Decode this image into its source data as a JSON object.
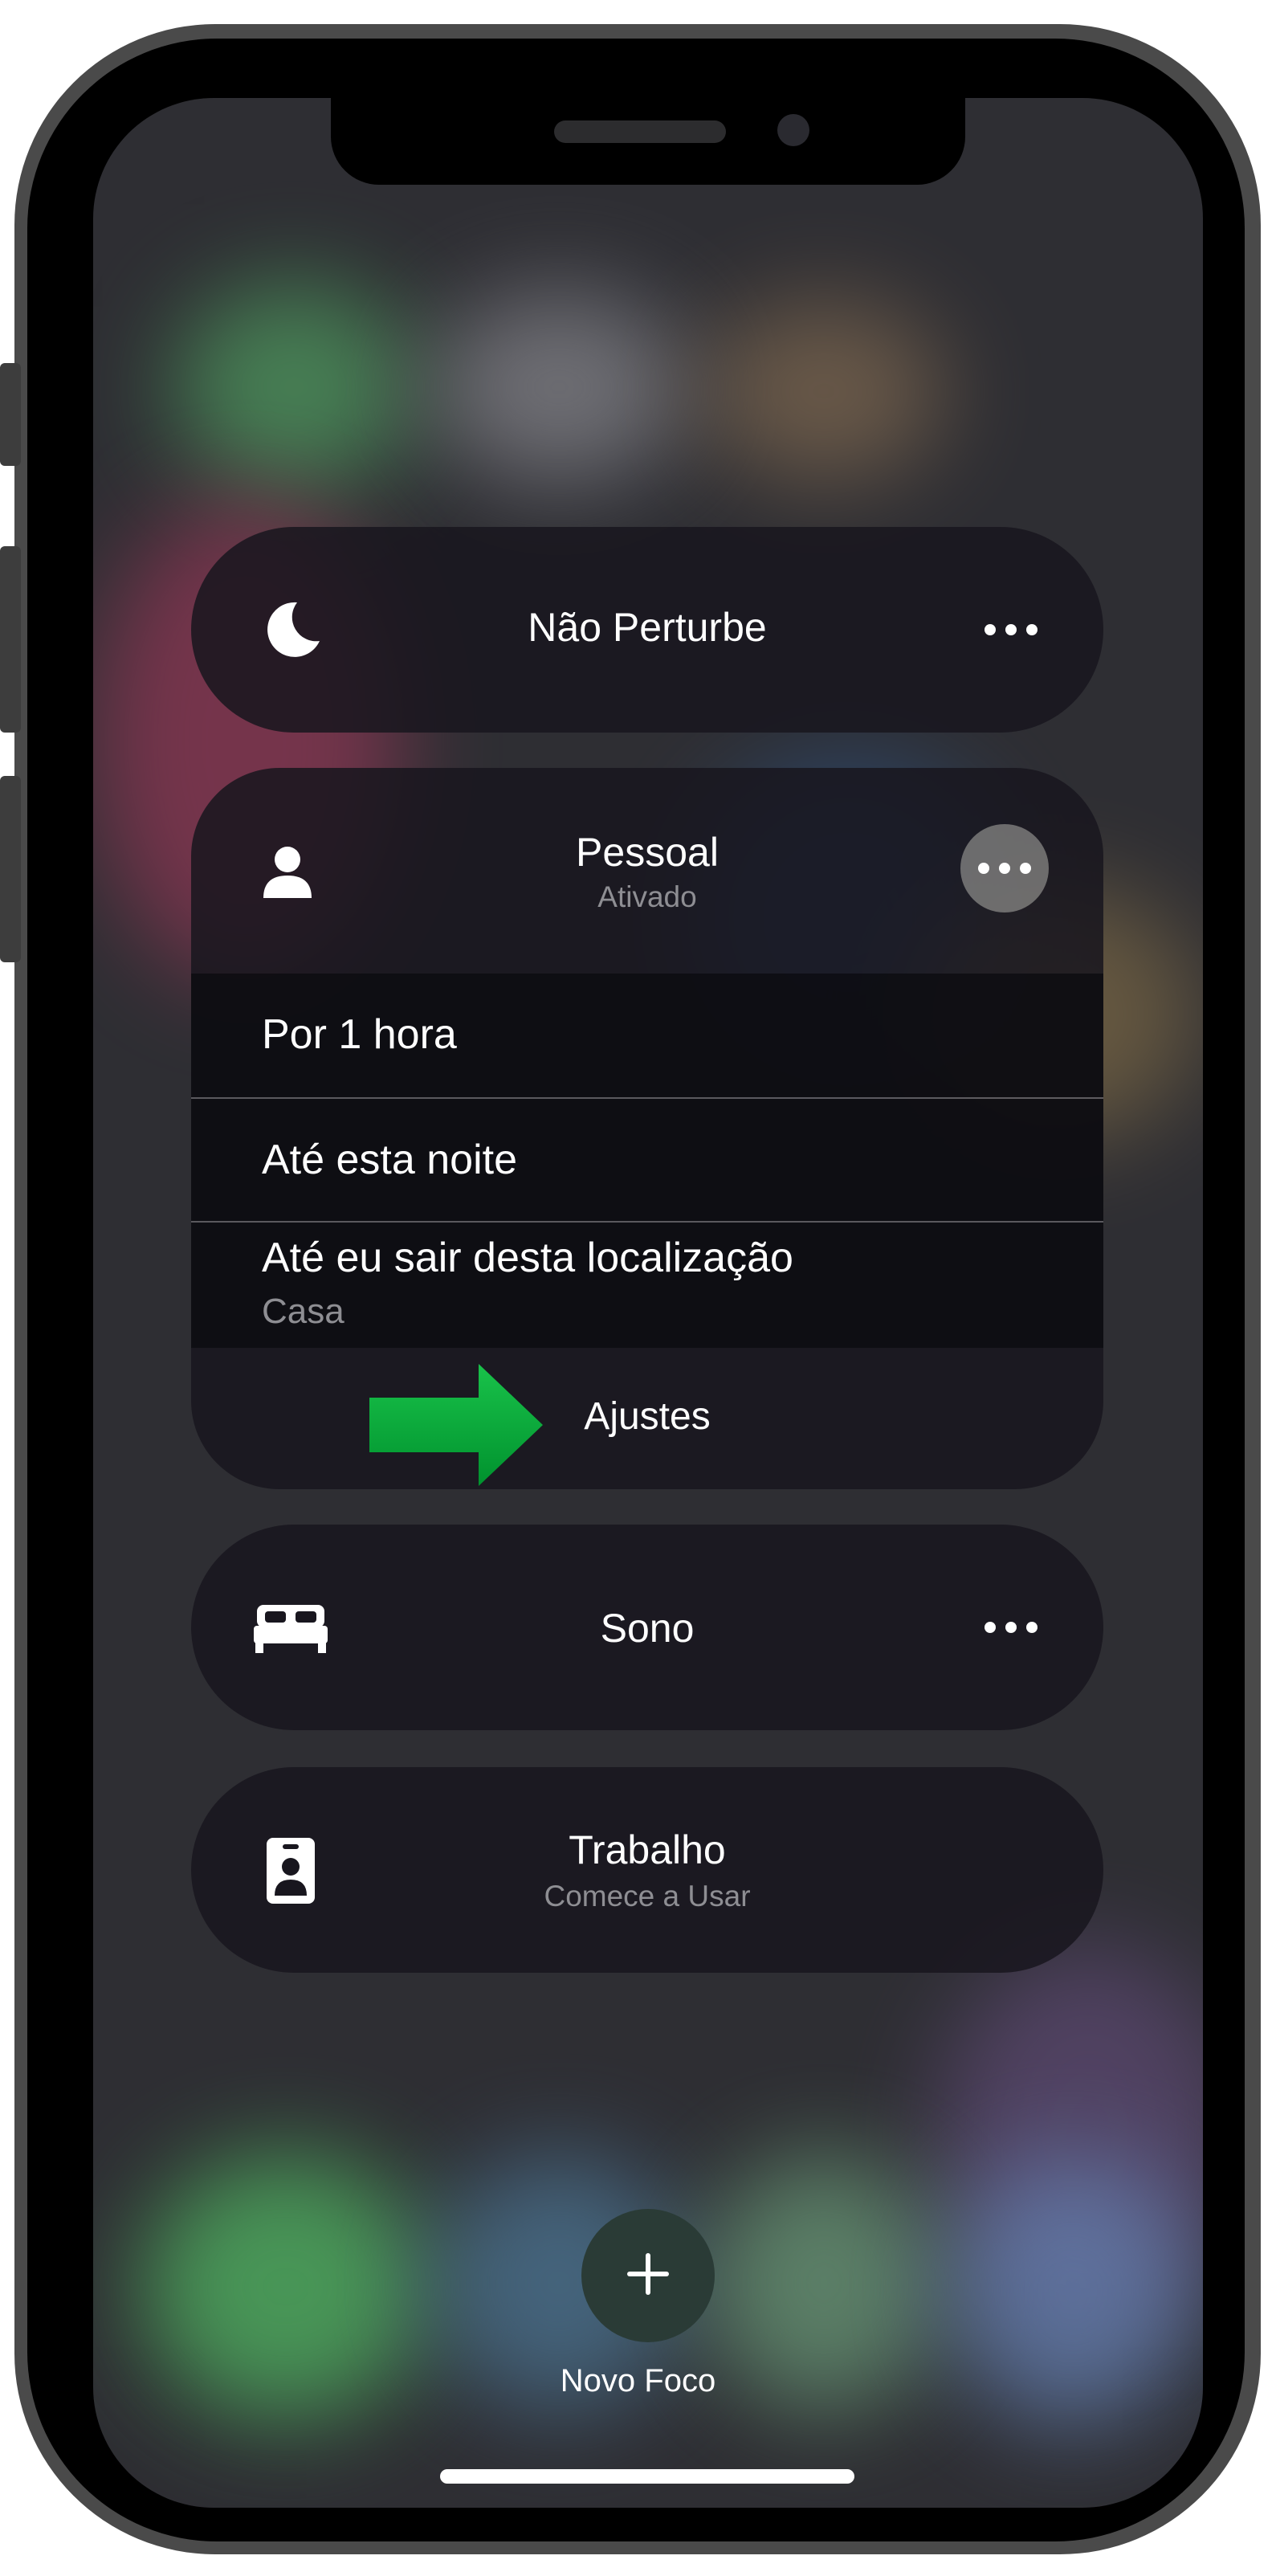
{
  "focus_modes": [
    {
      "id": "dnd",
      "title": "Não Perturbe",
      "icon": "moon-icon"
    },
    {
      "id": "personal",
      "title": "Pessoal",
      "subtitle": "Ativado",
      "icon": "person-icon"
    },
    {
      "id": "sleep",
      "title": "Sono",
      "icon": "bed-icon"
    },
    {
      "id": "work",
      "title": "Trabalho",
      "subtitle": "Comece a Usar",
      "icon": "id-badge-icon"
    }
  ],
  "personal_menu": {
    "options": [
      {
        "label": "Por 1 hora"
      },
      {
        "label": "Até esta noite"
      },
      {
        "label": "Até eu sair desta localização",
        "sublabel": "Casa"
      }
    ],
    "settings_label": "Ajustes",
    "annotation_arrow_color": "#00a33c"
  },
  "new_focus": {
    "label": "Novo Foco",
    "icon": "plus-icon"
  },
  "colors": {
    "pill_background": "#18161e",
    "text_primary": "#ffffff",
    "text_secondary": "#8e8e93"
  }
}
